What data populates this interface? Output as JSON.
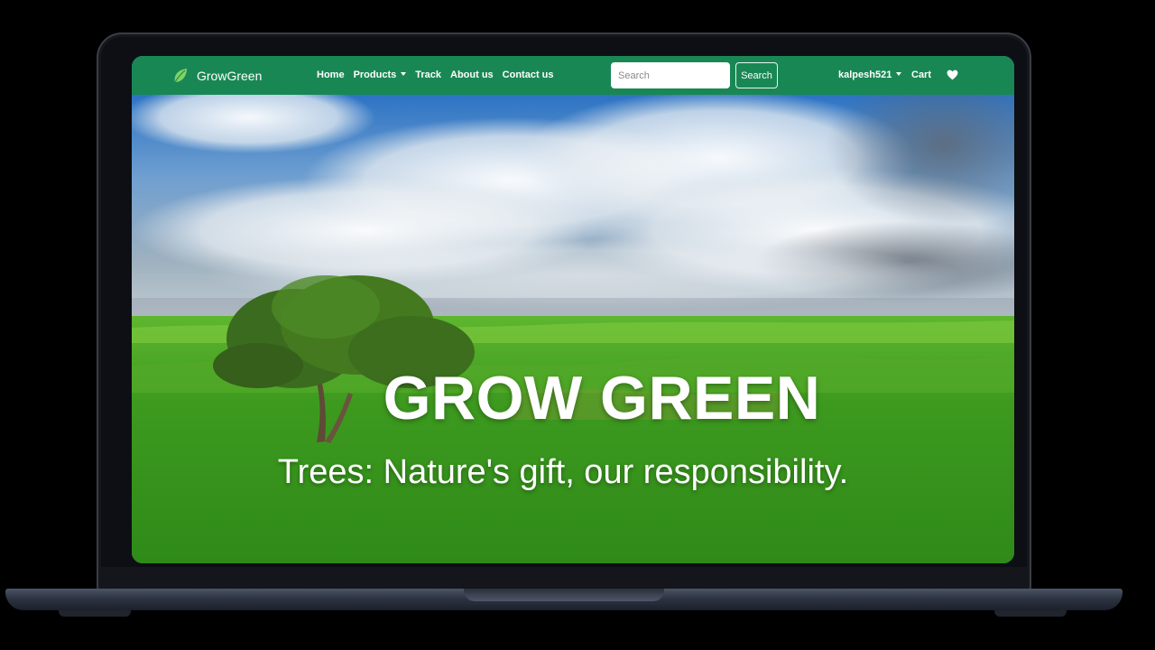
{
  "navbar": {
    "brand": "GrowGreen",
    "links": [
      "Home",
      "Products",
      "Track",
      "About us",
      "Contact us"
    ],
    "search": {
      "placeholder": "Search",
      "button_label": "Search"
    },
    "user": "kalpesh521",
    "cart_label": "Cart",
    "accent_color": "#198754"
  },
  "hero": {
    "title": "GROW GREEN",
    "subtitle": "Trees: Nature's gift, our responsibility."
  },
  "icons": {
    "brand": "leaf-icon",
    "dropdown": "caret-down-icon",
    "wishlist": "heart-icon"
  }
}
